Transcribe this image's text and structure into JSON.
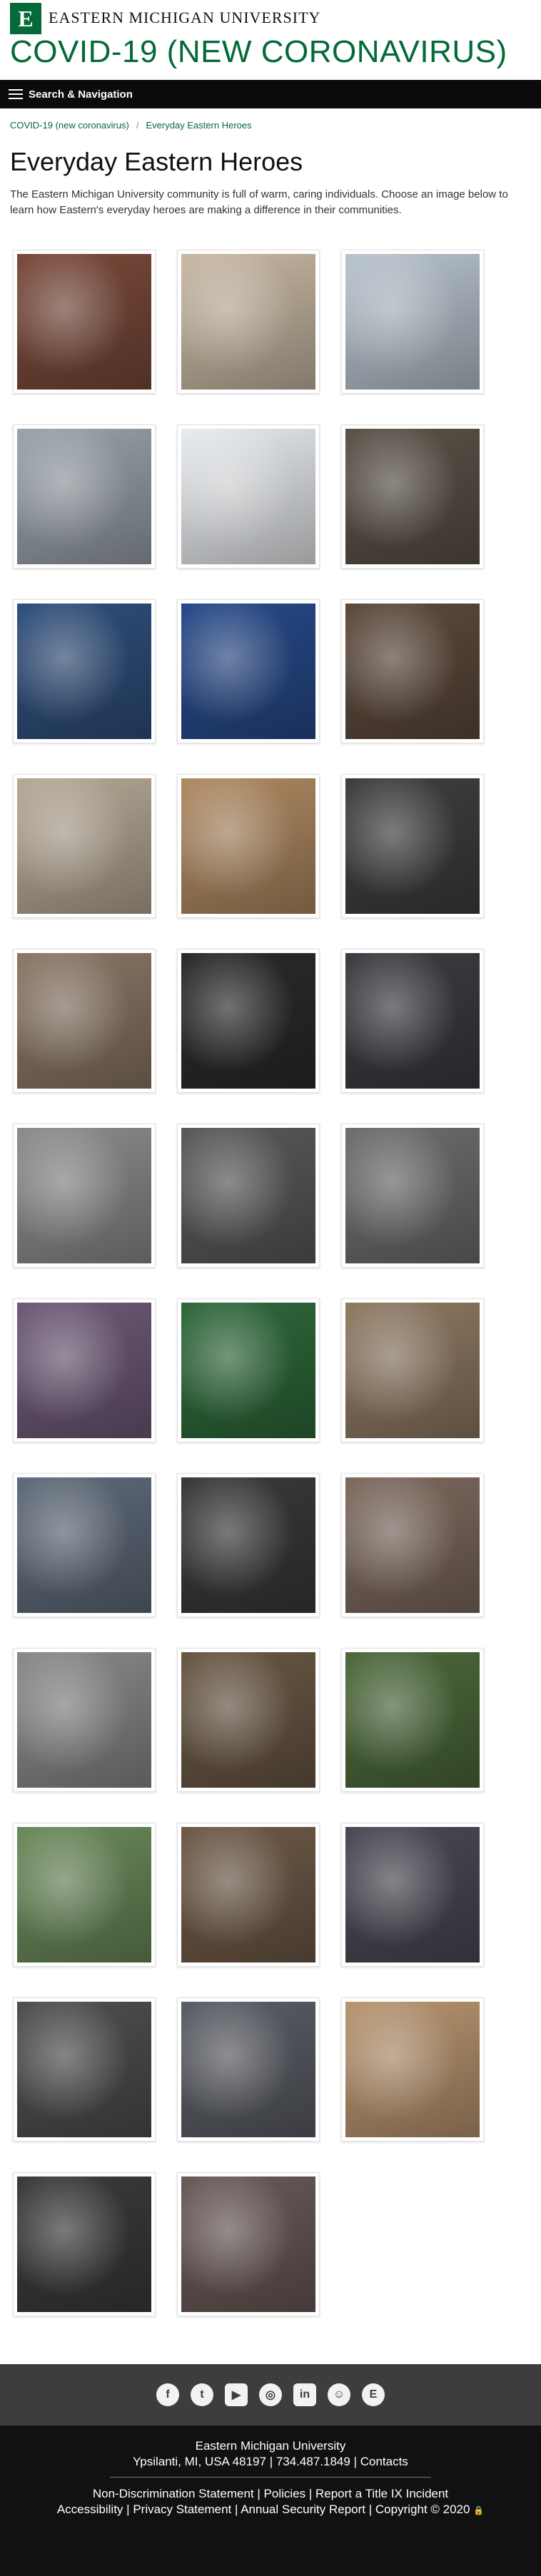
{
  "header": {
    "logo_letter": "E",
    "university_name": "EASTERN MICHIGAN UNIVERSITY",
    "site_title": "COVID-19 (NEW CORONAVIRUS)"
  },
  "nav": {
    "label": "Search & Navigation"
  },
  "breadcrumb": {
    "items": [
      "COVID-19 (new coronavirus)",
      "Everyday Eastern Heroes"
    ]
  },
  "page": {
    "title": "Everyday Eastern Heroes",
    "intro": "The Eastern Michigan University community is full of warm, caring individuals. Choose an image below to learn how Eastern's everyday heroes are making a difference in their communities."
  },
  "gallery": {
    "images": [
      {
        "name": "sewing-mask-photo",
        "bg": "#7a4a3a"
      },
      {
        "name": "woman-sewing-machine-photo",
        "bg": "#c9b9a4"
      },
      {
        "name": "face-shield-gown-photo",
        "bg": "#b9c4cf"
      },
      {
        "name": "face-shield-box-photo",
        "bg": "#9aa3ab"
      },
      {
        "name": "white-mask-photo",
        "bg": "#e9ecef"
      },
      {
        "name": "mask-stacks-photo",
        "bg": "#5b5248"
      },
      {
        "name": "colorful-mask-photo",
        "bg": "#2f4f7c"
      },
      {
        "name": "blue-masks-photo",
        "bg": "#274a8a"
      },
      {
        "name": "volunteer-porch-photo",
        "bg": "#5d4a3c"
      },
      {
        "name": "volunteers-boxes-photo",
        "bg": "#b7a997"
      },
      {
        "name": "cardboard-boxes-photo",
        "bg": "#b08a62"
      },
      {
        "name": "video-call-photo",
        "bg": "#3f3f3f"
      },
      {
        "name": "food-bags-photo",
        "bg": "#8b7766"
      },
      {
        "name": "police-officers-photo",
        "bg": "#2b2b2b"
      },
      {
        "name": "car-groceries-photo",
        "bg": "#3c3c42"
      },
      {
        "name": "laundry-machines-photo",
        "bg": "#8d8d8d"
      },
      {
        "name": "acrylic-box-photo",
        "bg": "#5a5a5a"
      },
      {
        "name": "acrylic-boxes-photo",
        "bg": "#6e6e6e"
      },
      {
        "name": "mask-gloves-photo",
        "bg": "#6e5a78"
      },
      {
        "name": "green-frames-photo",
        "bg": "#2e6a3a"
      },
      {
        "name": "safety-glasses-photo",
        "bg": "#8f7a63"
      },
      {
        "name": "man-glasses-photo",
        "bg": "#5f6b7a"
      },
      {
        "name": "man-selfie-photo",
        "bg": "#3a3a3a"
      },
      {
        "name": "delivery-porch-photo",
        "bg": "#7d6a5e"
      },
      {
        "name": "storage-bins-photo",
        "bg": "#8a8a8a"
      },
      {
        "name": "donation-box-photo",
        "bg": "#6a5845"
      },
      {
        "name": "women-selfie-photo",
        "bg": "#4d6a3b"
      },
      {
        "name": "two-women-photo",
        "bg": "#6b8a5a"
      },
      {
        "name": "kids-swoop-photo",
        "bg": "#6f5a48"
      },
      {
        "name": "kids-car-trunk-photo",
        "bg": "#4a4a55"
      },
      {
        "name": "supply-cart-photo",
        "bg": "#4f4f4f"
      },
      {
        "name": "suv-donations-photo",
        "bg": "#5b5e66"
      },
      {
        "name": "boxes-stacked-photo",
        "bg": "#b99570"
      },
      {
        "name": "pickup-truck-photo",
        "bg": "#3b3b3b"
      },
      {
        "name": "building-entrance-photo",
        "bg": "#6a5a58"
      }
    ]
  },
  "footer": {
    "social": [
      {
        "name": "facebook-icon",
        "glyph": "f"
      },
      {
        "name": "twitter-icon",
        "glyph": "t"
      },
      {
        "name": "youtube-icon",
        "glyph": "▶"
      },
      {
        "name": "instagram-icon",
        "glyph": "◎"
      },
      {
        "name": "linkedin-icon",
        "glyph": "in"
      },
      {
        "name": "snapchat-icon",
        "glyph": "☺"
      },
      {
        "name": "flickr-icon",
        "glyph": "E"
      }
    ],
    "org": "Eastern Michigan University",
    "address": "Ypsilanti, MI, USA 48197",
    "phone": "734.487.1849",
    "contacts": "Contacts",
    "link_nondiscrimination": "Non-Discrimination Statement",
    "link_policies": "Policies",
    "link_report_title_ix": "Report a Title IX Incident",
    "link_accessibility": "Accessibility",
    "link_privacy": "Privacy Statement",
    "link_annual_security": "Annual Security Report",
    "copyright": "Copyright © 2020",
    "lock_icon": "🔒"
  }
}
